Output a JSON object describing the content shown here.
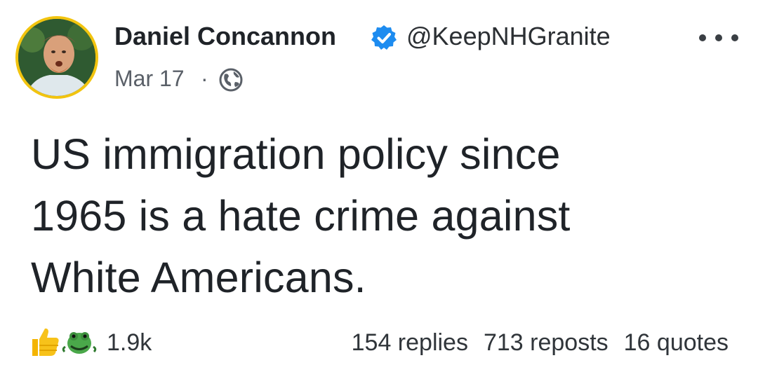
{
  "author": {
    "name": "Daniel Concannon",
    "handle": "@KeepNHGranite",
    "verified": true,
    "avatar_border_color": "#f2c40f"
  },
  "meta": {
    "date": "Mar 17",
    "separator": "·",
    "visibility_icon": "globe-icon"
  },
  "post": {
    "text": "US immigration policy since\n1965 is a hate crime against\nWhite Americans."
  },
  "footer": {
    "reaction_icons": [
      "thumbs-up-icon",
      "custom-frog-reaction-icon"
    ],
    "reaction_count": "1.9k",
    "replies": "154 replies",
    "reposts": "713 reposts",
    "quotes": "16 quotes"
  },
  "colors": {
    "verified_blue": "#1d8cf0",
    "text_primary": "#1f2328",
    "text_secondary": "#5a6068"
  }
}
